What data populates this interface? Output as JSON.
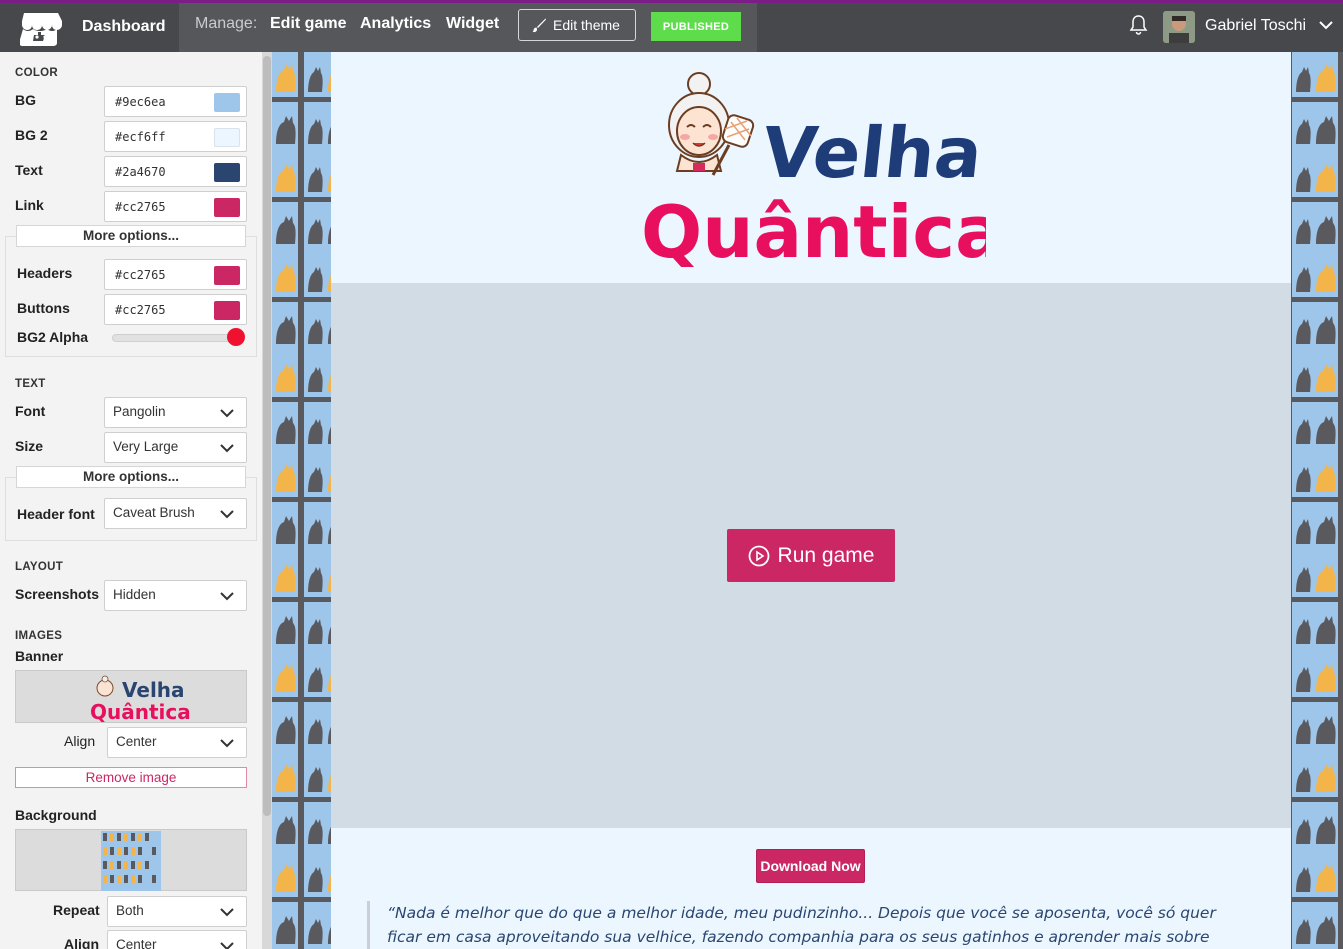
{
  "topbar": {
    "dashboard": "Dashboard",
    "manage_label": "Manage:",
    "nav": [
      "Edit game",
      "Analytics",
      "Widget"
    ],
    "edit_theme": "Edit theme",
    "published": "PUBLISHED",
    "user_name": "Gabriel Toschi"
  },
  "sidebar": {
    "color_title": "COLOR",
    "colors": [
      {
        "label": "BG",
        "value": "#9ec6ea"
      },
      {
        "label": "BG 2",
        "value": "#ecf6ff"
      },
      {
        "label": "Text",
        "value": "#2a4670"
      },
      {
        "label": "Link",
        "value": "#cc2765"
      }
    ],
    "more_options": "More options...",
    "extra_colors": [
      {
        "label": "Headers",
        "value": "#cc2765"
      },
      {
        "label": "Buttons",
        "value": "#cc2765"
      }
    ],
    "bg2_alpha_label": "BG2 Alpha",
    "bg2_alpha_value": 1.0,
    "text_title": "TEXT",
    "font_label": "Font",
    "font_value": "Pangolin",
    "size_label": "Size",
    "size_value": "Very Large",
    "more_options_2": "More options...",
    "header_font_label": "Header font",
    "header_font_value": "Caveat Brush",
    "layout_title": "LAYOUT",
    "screenshots_label": "Screenshots",
    "screenshots_value": "Hidden",
    "images_title": "IMAGES",
    "banner_label": "Banner",
    "banner_thumb_line1": "Velha",
    "banner_thumb_line2": "Quântica",
    "align_label": "Align",
    "align_value": "Center",
    "remove_image": "Remove image",
    "background_label": "Background",
    "repeat_label": "Repeat",
    "repeat_value": "Both",
    "align2_label": "Align",
    "align2_value": "Center"
  },
  "preview": {
    "logo_line1": "Velha",
    "logo_line2": "Quântica",
    "run_game": "Run game",
    "download_now": "Download Now",
    "quote_line1": "“Nada é melhor que do que a melhor idade, meu pudinzinho... Depois que você se aposenta, você só quer",
    "quote_line2": "ficar em casa aproveitando sua velhice, fazendo companhia para os seus gatinhos e aprender mais sobre"
  },
  "theme": {
    "bg": "#9ec6ea",
    "bg2": "#ecf6ff",
    "text": "#2a4670",
    "link": "#cc2765",
    "published_green": "#5fdc4b",
    "topbar_accent": "#7a1d86"
  }
}
